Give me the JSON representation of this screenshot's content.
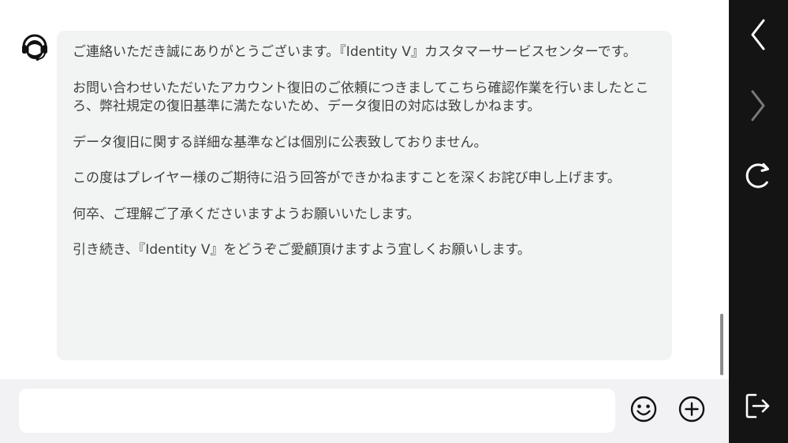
{
  "chat": {
    "messages": [
      {
        "sender": "agent",
        "paragraphs": [
          "ご連絡いただき誠にありがとうございます。『Identity V』カスタマーサービスセンターです。",
          "お問い合わせいただいたアカウント復旧のご依頼につきましてこちら確認作業を行いましたところ、弊社規定の復旧基準に満たないため、データ復旧の対応は致しかねます。",
          "データ復旧に関する詳細な基準などは個別に公表致しておりません。",
          "この度はプレイヤー様のご期待に沿う回答ができかねますことを深くお詫び申し上げます。",
          "何卒、ご理解ご了承くださいますようお願いいたします。",
          "引き続き、『Identity V』をどうぞご愛顧頂けますよう宜しくお願いします。"
        ]
      }
    ]
  },
  "composer": {
    "input_value": "",
    "input_placeholder": ""
  },
  "icons": {
    "avatar": "headset-agent-icon",
    "emoji": "smiley-face-icon",
    "attach": "circle-plus-icon",
    "back": "chevron-left-icon",
    "forward": "chevron-right-icon",
    "reload": "reload-icon",
    "exit": "exit-icon"
  },
  "colors": {
    "bubble_bg": "#f2f3f3",
    "text": "#3f3f3f",
    "input_bar_bg": "#f2f2f4",
    "sidebar_bg": "#141414",
    "sidebar_icon_active": "#ffffff",
    "sidebar_icon_disabled": "#7a7a7a"
  }
}
